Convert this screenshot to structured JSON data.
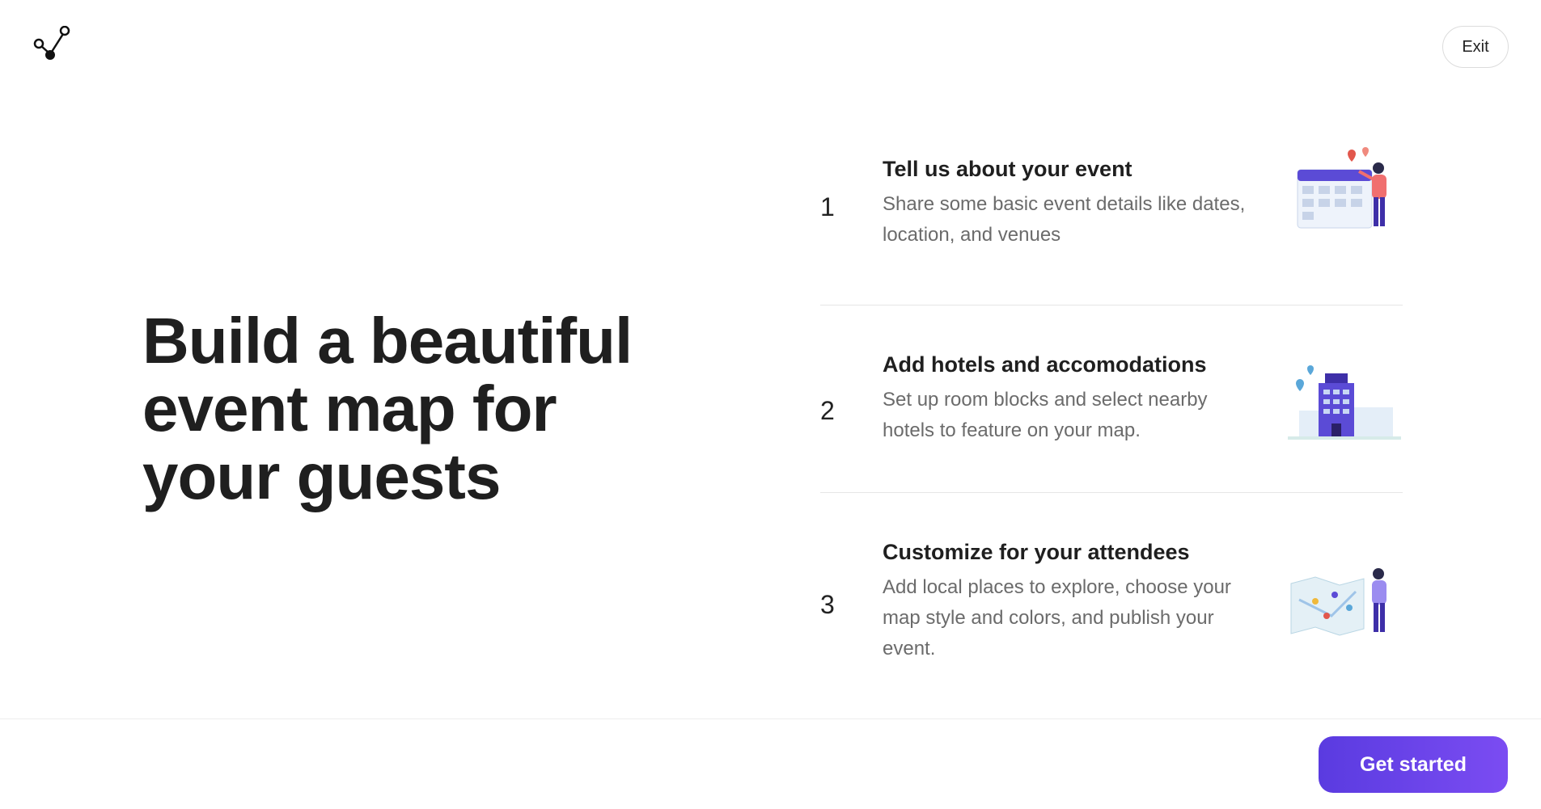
{
  "header": {
    "logo_icon": "graph-node-logo",
    "exit_label": "Exit"
  },
  "hero": {
    "headline_line1": "Build a beautiful",
    "headline_line2": "event map for",
    "headline_line3": "your guests"
  },
  "steps": [
    {
      "number": "1",
      "title": "Tell us about your event",
      "description": "Share some basic event details like dates, location, and venues",
      "illustration": "calendar-illustration"
    },
    {
      "number": "2",
      "title": "Add hotels and accomodations",
      "description": "Set up room blocks and select nearby hotels to feature on your map.",
      "illustration": "hotel-illustration"
    },
    {
      "number": "3",
      "title": "Customize for your attendees",
      "description": "Add local places to explore, choose your map style and colors, and publish your event.",
      "illustration": "map-illustration"
    }
  ],
  "footer": {
    "cta_label": "Get started"
  },
  "colors": {
    "accent": "#5a3be0",
    "accent_light": "#7b4cf2",
    "text_primary": "#1f1f1f",
    "text_secondary": "#6b6b6b",
    "divider": "#e6e6e6"
  }
}
